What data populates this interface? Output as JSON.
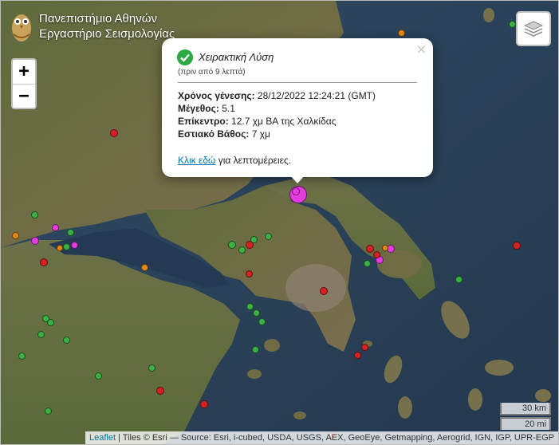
{
  "header": {
    "line1": "Πανεπιστήμιο Αθηνών",
    "line2": "Εργαστήριο Σεισμολογίας"
  },
  "zoom": {
    "in_label": "+",
    "out_label": "−"
  },
  "popup": {
    "title": "Χειρακτική Λύση",
    "ago": "(πριν από 9 λεπτά)",
    "origin_label": "Χρόνος γένεσης:",
    "origin_value": "28/12/2022 12:24:21 (GMT)",
    "magnitude_label": "Μέγεθος:",
    "magnitude_value": "5.1",
    "epicenter_label": "Επίκεντρο:",
    "epicenter_value": "12.7 χμ ΒΑ της Χαλκίδας",
    "depth_label": "Εστιακό Βάθος:",
    "depth_value": "7 χμ",
    "link_label": "Κλικ εδώ",
    "link_suffix": " για λεπτομέρειες.",
    "close_label": "×"
  },
  "scale": {
    "km": "30 km",
    "mi": "20 mi"
  },
  "attribution": {
    "leaflet": "Leaflet",
    "text": " | Tiles © Esri — Source: Esri, i-cubed, USDA, USGS, AEX, GeoEye, Getmapping, Aerogrid, IGN, IGP, UPR-EGP"
  },
  "colors": {
    "recent": "#e53be0",
    "day": "#e38a1a",
    "week": "#d42222",
    "older": "#3cb043",
    "check": "#2eaa45",
    "link": "#0078a8"
  }
}
